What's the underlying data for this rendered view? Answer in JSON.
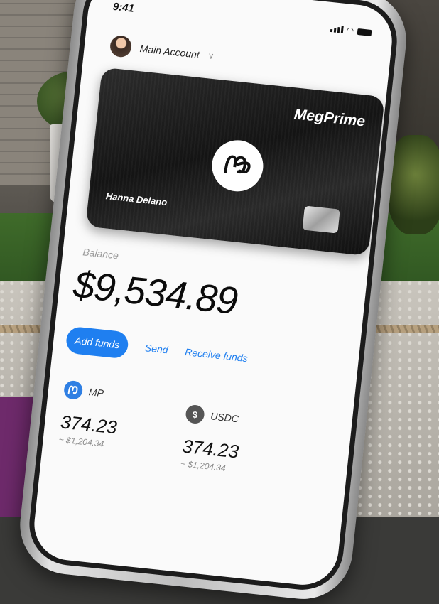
{
  "status_bar": {
    "time": "9:41"
  },
  "account": {
    "name": "Main Account"
  },
  "card": {
    "brand": "MegPrime",
    "holder": "Hanna Delano"
  },
  "balance": {
    "label": "Balance",
    "value": "$9,534.89"
  },
  "actions": {
    "add_funds": "Add funds",
    "send": "Send",
    "receive": "Receive funds"
  },
  "assets": [
    {
      "symbol": "MP",
      "amount": "374.23",
      "fiat": "~ $1,204.34",
      "icon": "mp-coin-icon",
      "color": "#2f7fe3"
    },
    {
      "symbol": "USDC",
      "amount": "374.23",
      "fiat": "~ $1,204.34",
      "icon": "dollar-coin-icon",
      "color": "#555555"
    }
  ],
  "colors": {
    "accent": "#1f7ff0",
    "card": "#141414",
    "screen": "#fafafa"
  }
}
